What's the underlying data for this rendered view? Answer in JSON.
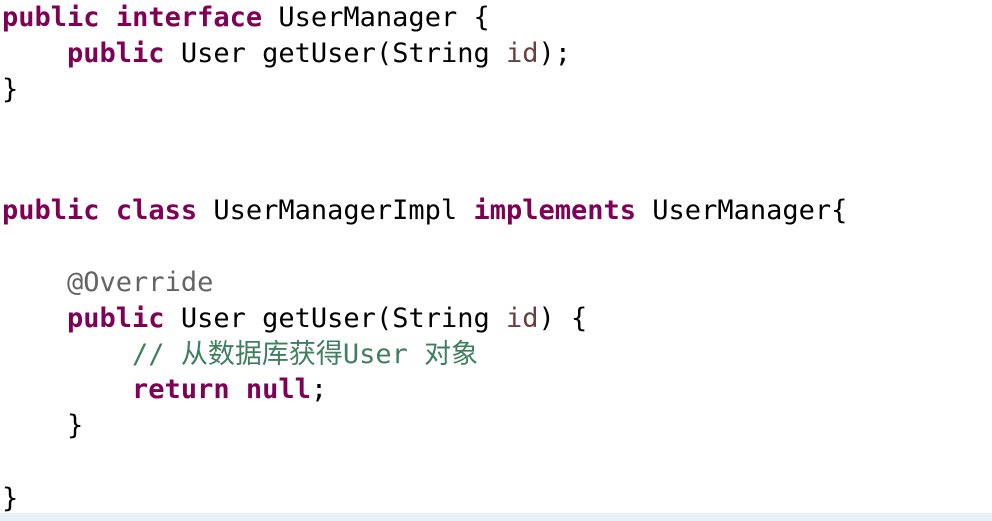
{
  "code": {
    "interface_kw_public": "public",
    "interface_kw_interface": "interface",
    "interface_name": "UserManager",
    "open_brace": "{",
    "close_brace": "}",
    "method_kw_public": "public",
    "return_type": "User",
    "method_name": "getUser",
    "open_paren": "(",
    "param_type": "String",
    "param_name": "id",
    "close_paren_semicolon": ");",
    "class_kw_public": "public",
    "class_kw_class": "class",
    "class_name": "UserManagerImpl",
    "implements_kw": "implements",
    "implemented_interface": "UserManager{",
    "annotation": "@Override",
    "close_paren_brace": ") {",
    "comment": "// 从数据库获得User 对象",
    "return_kw": "return",
    "null_kw": "null",
    "semicolon": ";"
  },
  "colors": {
    "keyword": "#7f0055",
    "annotation": "#646464",
    "parameter": "#6a3e3e",
    "comment": "#3f7f5f",
    "plain": "#000000"
  }
}
